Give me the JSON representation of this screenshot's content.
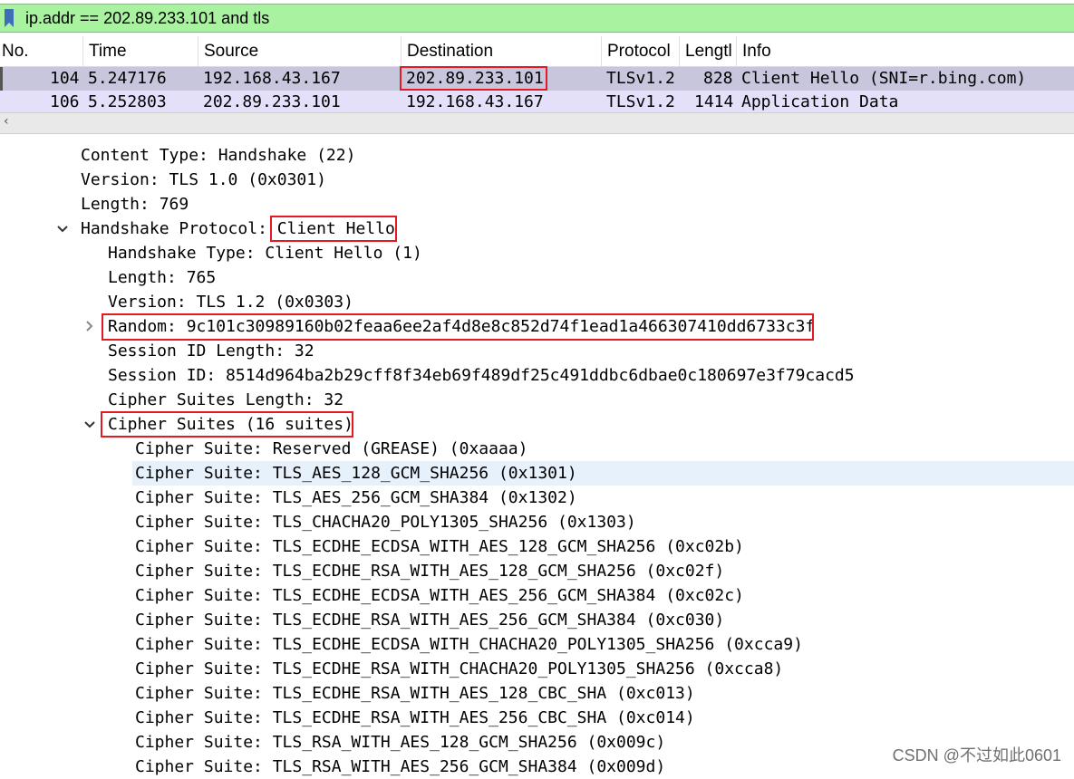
{
  "filter": {
    "text": "ip.addr == 202.89.233.101 and tls"
  },
  "columns": {
    "no": "No.",
    "time": "Time",
    "source": "Source",
    "destination": "Destination",
    "protocol": "Protocol",
    "length": "Lengtl",
    "info": "Info"
  },
  "packets": [
    {
      "no": "104",
      "time": "5.247176",
      "source": "192.168.43.167",
      "destination": "202.89.233.101",
      "protocol": "TLSv1.2",
      "length": "828",
      "info": "Client Hello (SNI=r.bing.com)",
      "selected": true
    },
    {
      "no": "106",
      "time": "5.252803",
      "source": "202.89.233.101",
      "destination": "192.168.43.167",
      "protocol": "TLSv1.2",
      "length": "1414",
      "info": "Application Data",
      "selected": false
    }
  ],
  "details": {
    "content_type": "Content Type: Handshake (22)",
    "version": "Version: TLS 1.0 (0x0301)",
    "length": "Length: 769",
    "handshake_prefix": "Handshake Protocol: ",
    "handshake_value": "Client Hello",
    "handshake_type": "Handshake Type: Client Hello (1)",
    "hs_length": "Length: 765",
    "hs_version": "Version: TLS 1.2 (0x0303)",
    "random": "Random: 9c101c30989160b02feaa6ee2af4d8e8c852d74f1ead1a466307410dd6733c3f",
    "session_id_length": "Session ID Length: 32",
    "session_id": "Session ID: 8514d964ba2b29cff8f34eb69f489df25c491ddbc6dbae0c180697e3f79cacd5",
    "cipher_suites_length": "Cipher Suites Length: 32",
    "cipher_suites": "Cipher Suites (16 suites)",
    "suites": [
      "Cipher Suite: Reserved (GREASE) (0xaaaa)",
      "Cipher Suite: TLS_AES_128_GCM_SHA256 (0x1301)",
      "Cipher Suite: TLS_AES_256_GCM_SHA384 (0x1302)",
      "Cipher Suite: TLS_CHACHA20_POLY1305_SHA256 (0x1303)",
      "Cipher Suite: TLS_ECDHE_ECDSA_WITH_AES_128_GCM_SHA256 (0xc02b)",
      "Cipher Suite: TLS_ECDHE_RSA_WITH_AES_128_GCM_SHA256 (0xc02f)",
      "Cipher Suite: TLS_ECDHE_ECDSA_WITH_AES_256_GCM_SHA384 (0xc02c)",
      "Cipher Suite: TLS_ECDHE_RSA_WITH_AES_256_GCM_SHA384 (0xc030)",
      "Cipher Suite: TLS_ECDHE_ECDSA_WITH_CHACHA20_POLY1305_SHA256 (0xcca9)",
      "Cipher Suite: TLS_ECDHE_RSA_WITH_CHACHA20_POLY1305_SHA256 (0xcca8)",
      "Cipher Suite: TLS_ECDHE_RSA_WITH_AES_128_CBC_SHA (0xc013)",
      "Cipher Suite: TLS_ECDHE_RSA_WITH_AES_256_CBC_SHA (0xc014)",
      "Cipher Suite: TLS_RSA_WITH_AES_128_GCM_SHA256 (0x009c)",
      "Cipher Suite: TLS_RSA_WITH_AES_256_GCM_SHA384 (0x009d)"
    ]
  },
  "watermark": "CSDN @不过如此0601",
  "colors": {
    "filter_bg": "#a9f2a0",
    "selected_row": "#c8c6dc",
    "second_row": "#e4e0fa",
    "highlight_box": "#e01b24",
    "hover_row": "#e6f1fc"
  },
  "icons": {
    "bookmark": "bookmark-icon",
    "scroll_left": "scroll-left-icon",
    "expand": "chevron-down-icon",
    "collapsed": "chevron-right-icon"
  }
}
